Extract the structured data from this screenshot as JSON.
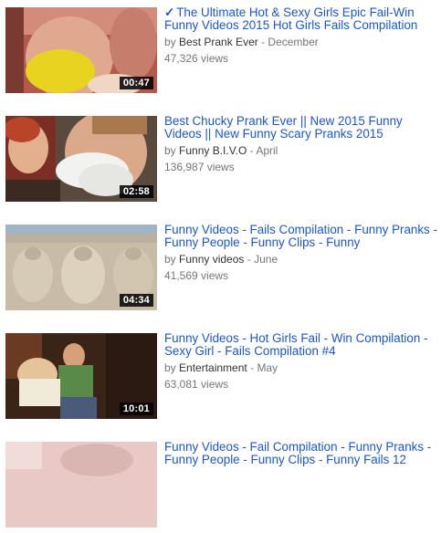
{
  "videos": [
    {
      "title": "The Ultimate Hot & Sexy Girls Epic Fail-Win Funny Videos 2015 Hot Girls Fails Compilation",
      "verified_mark": "✓",
      "by_prefix": "by",
      "channel": "Best Prank Ever",
      "separator": "-",
      "date": "December",
      "views": "47,326 views",
      "duration": "00:47"
    },
    {
      "title": "Best Chucky Prank Ever || New 2015 Funny Videos || New Funny Scary Pranks 2015",
      "verified_mark": "",
      "by_prefix": "by",
      "channel": "Funny B.I.V.O",
      "separator": "-",
      "date": "April",
      "views": "136,987 views",
      "duration": "02:58"
    },
    {
      "title": "Funny Videos - Fails Compilation - Funny Pranks - Funny People - Funny Clips - Funny",
      "verified_mark": "",
      "by_prefix": "by",
      "channel": "Funny videos",
      "separator": "-",
      "date": "June",
      "views": "41,569 views",
      "duration": "04:34"
    },
    {
      "title": "Funny Videos - Hot Girls Fail - Win Compilation - Sexy Girl - Fails Compilation #4",
      "verified_mark": "",
      "by_prefix": "by",
      "channel": "Entertainment",
      "separator": "-",
      "date": "May",
      "views": "63,081 views",
      "duration": "10:01"
    },
    {
      "title": "Funny Videos - Fail Compilation - Funny Pranks - Funny People - Funny Clips - Funny Fails 12",
      "verified_mark": "",
      "by_prefix": "",
      "channel": "",
      "separator": "",
      "date": "",
      "views": "",
      "duration": ""
    }
  ],
  "colors": {
    "link": "#1a56d6",
    "meta_text": "#767676",
    "channel_text": "#333333",
    "duration_bg": "#000000"
  }
}
